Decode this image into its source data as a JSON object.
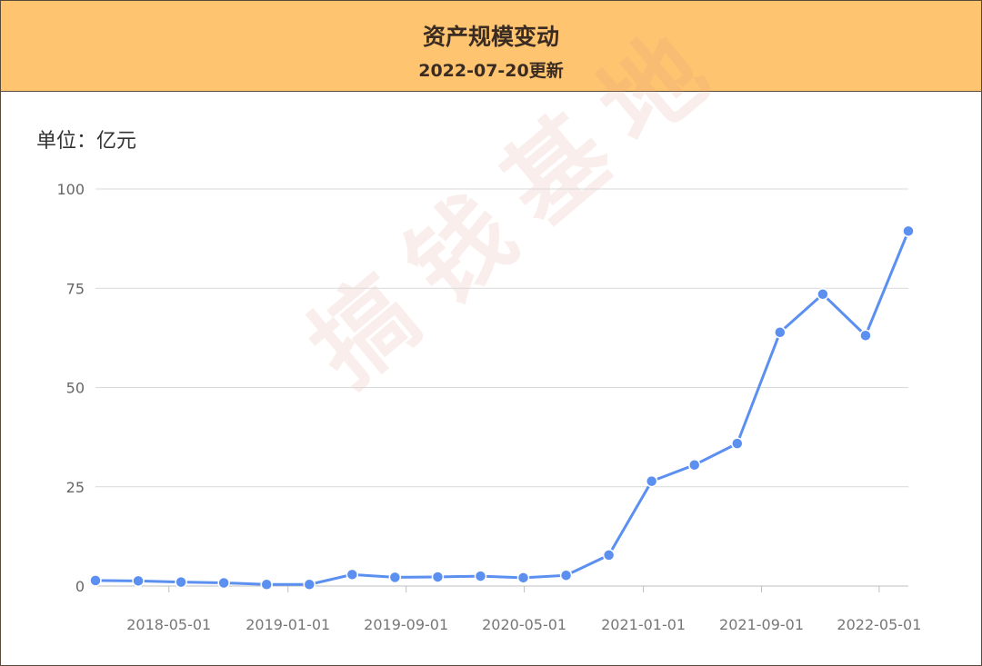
{
  "header": {
    "title": "资产规模变动",
    "subtitle": "2022-07-20更新"
  },
  "unit_label": "单位：亿元",
  "watermark": "搞钱基地",
  "colors": {
    "header_bg": "#ffc470",
    "line": "#5b8ff0",
    "grid": "#d9d9d9",
    "axis_text": "#666666"
  },
  "chart_data": {
    "type": "line",
    "title": "资产规模变动",
    "subtitle": "2022-07-20更新",
    "ylabel": "单位：亿元",
    "ylim": [
      0,
      100
    ],
    "yticks": [
      "0",
      "25",
      "50",
      "75",
      "100"
    ],
    "xticks": [
      "2018-05-01",
      "2019-01-01",
      "2019-09-01",
      "2020-05-01",
      "2021-01-01",
      "2021-09-01",
      "2022-05-01"
    ],
    "grid": true,
    "x": [
      "2017-12-31",
      "2018-03-31",
      "2018-06-30",
      "2018-09-30",
      "2018-12-31",
      "2019-03-31",
      "2019-06-30",
      "2019-09-30",
      "2019-12-31",
      "2020-03-31",
      "2020-06-30",
      "2020-09-30",
      "2020-12-31",
      "2021-03-31",
      "2021-06-30",
      "2021-09-30",
      "2021-12-31",
      "2022-03-31",
      "2022-06-30"
    ],
    "series": [
      {
        "values": [
          1.4,
          1.3,
          1.0,
          0.8,
          0.4,
          0.4,
          2.9,
          2.2,
          2.3,
          2.5,
          2.1,
          2.7,
          7.8,
          26.4,
          30.5,
          35.9,
          63.9,
          73.5,
          63.1,
          89.4
        ]
      }
    ]
  }
}
